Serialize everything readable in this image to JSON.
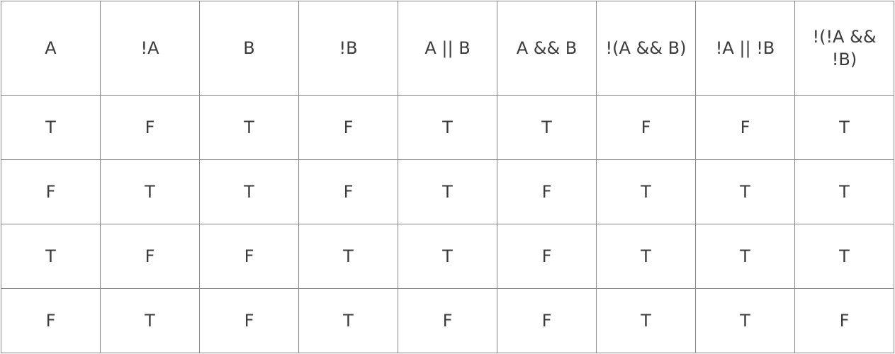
{
  "table": {
    "headers": [
      "A",
      "!A",
      "B",
      "!B",
      "A || B",
      "A && B",
      "!(A && B)",
      "!A || !B",
      "!(!A && !B)"
    ],
    "rows": [
      [
        "T",
        "F",
        "T",
        "F",
        "T",
        "T",
        "F",
        "F",
        "T"
      ],
      [
        "F",
        "T",
        "T",
        "F",
        "T",
        "F",
        "T",
        "T",
        "T"
      ],
      [
        "T",
        "F",
        "F",
        "T",
        "T",
        "F",
        "T",
        "T",
        "T"
      ],
      [
        "F",
        "T",
        "F",
        "T",
        "F",
        "F",
        "T",
        "T",
        "F"
      ]
    ]
  }
}
